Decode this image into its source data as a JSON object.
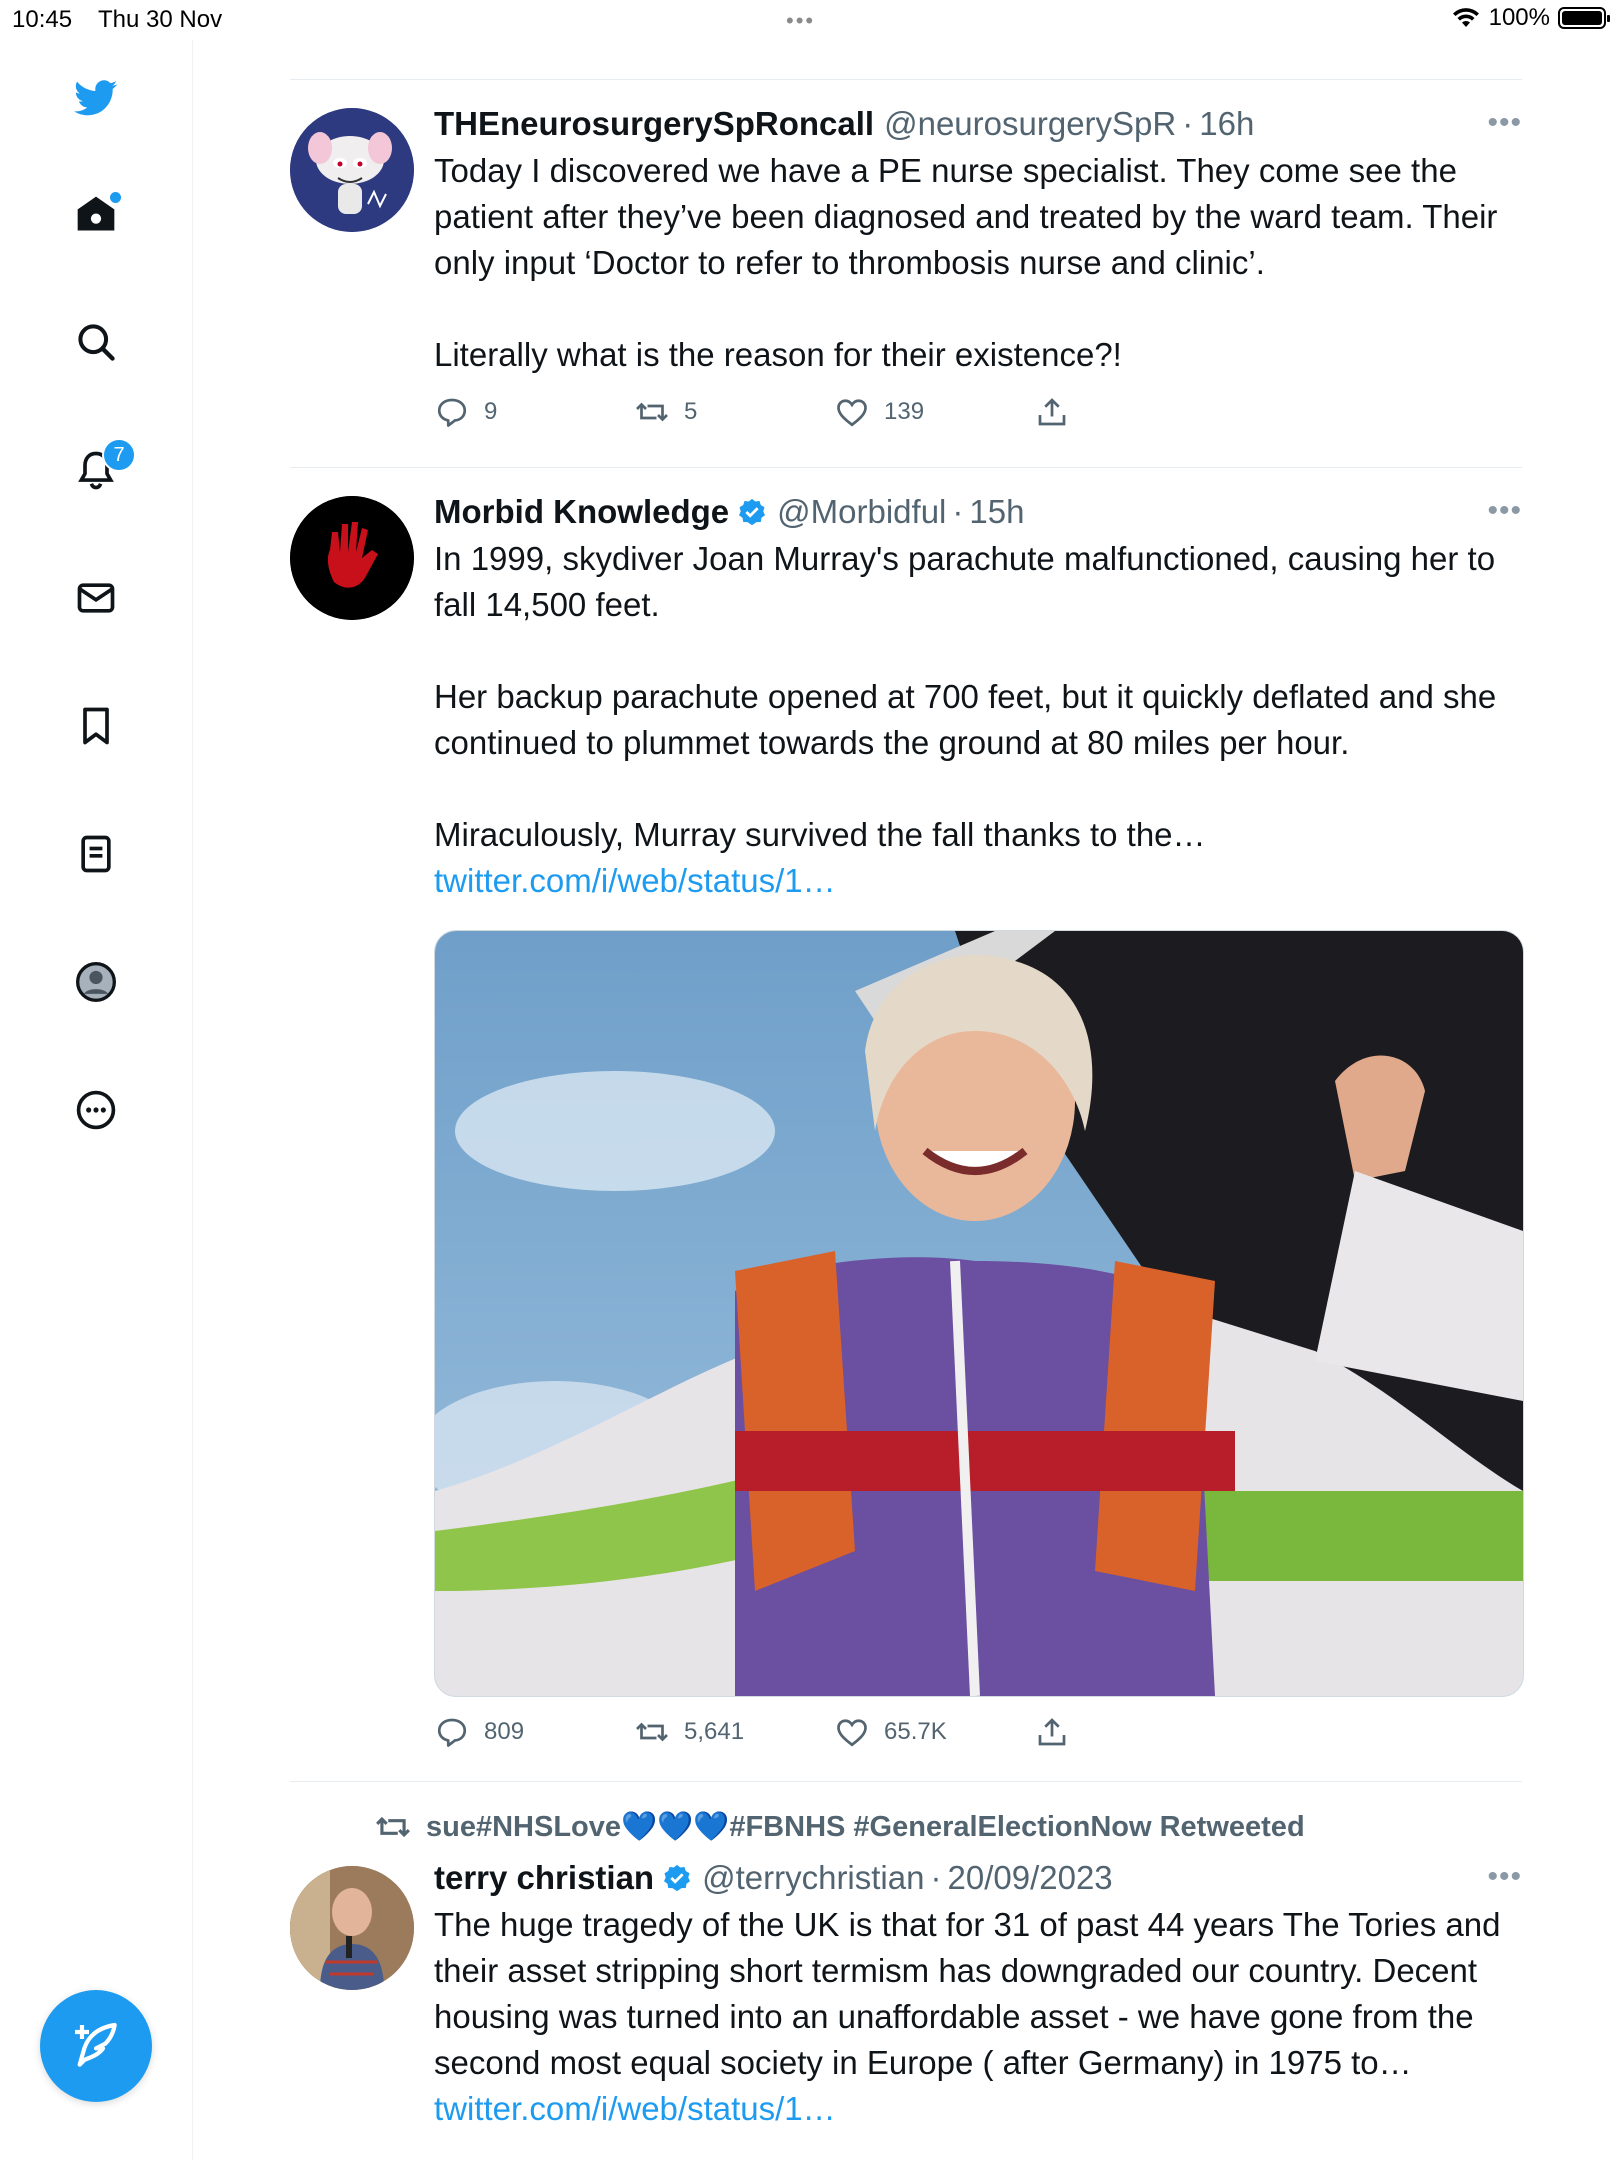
{
  "status_bar": {
    "time": "10:45",
    "date": "Thu 30 Nov",
    "battery": "100%"
  },
  "sidebar": {
    "notifications_count": "7"
  },
  "tweets": [
    {
      "name": "THEneurosurgerySpRoncall",
      "handle": "@neurosurgerySpR",
      "time": "16h",
      "text": "Today I discovered we have a PE nurse specialist. They come see the patient after they’ve been diagnosed and treated by the ward team. Their only input ‘Doctor to refer to thrombosis nurse and clinic’.\n\nLiterally what is the reason for their existence?!",
      "replies": "9",
      "retweets": "5",
      "likes": "139"
    },
    {
      "name": "Morbid Knowledge",
      "handle": "@Morbidful",
      "time": "15h",
      "text": "In 1999, skydiver Joan Murray's parachute malfunctioned, causing her to fall 14,500 feet.\n\nHer backup parachute opened at 700 feet, but it quickly deflated and she continued to plummet towards the ground at 80 miles per hour.\n\nMiraculously, Murray survived the fall thanks to the… ",
      "link": "twitter.com/i/web/status/1…",
      "replies": "809",
      "retweets": "5,641",
      "likes": "65.7K"
    },
    {
      "retweeted_by": "sue#NHSLove💙💙💙#FBNHS #GeneralElectionNow Retweeted",
      "name": "terry christian",
      "handle": "@terrychristian",
      "time": "20/09/2023",
      "text": "The huge tragedy of the UK is that for 31 of past 44 years The Tories and their asset stripping short termism has downgraded our country. Decent housing was turned into an unaffordable asset - we have gone from the second most equal society in Europe ( after Germany) in 1975 to… ",
      "link": "twitter.com/i/web/status/1…"
    }
  ],
  "colors": {
    "accent": "#1d9bf0",
    "muted": "#536471",
    "text": "#0f1419"
  }
}
